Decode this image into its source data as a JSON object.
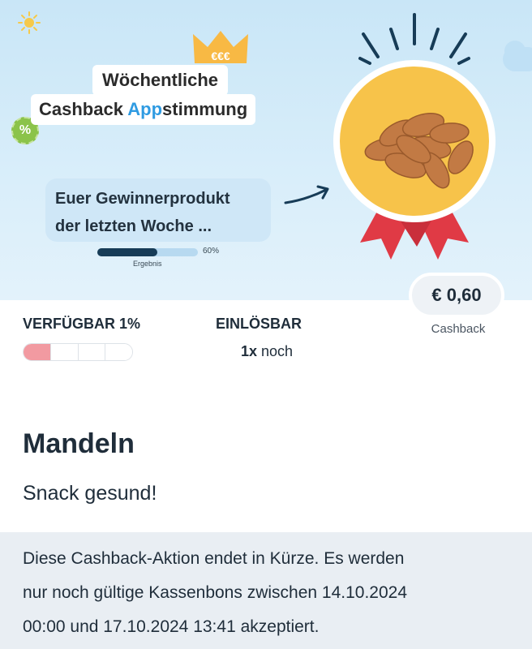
{
  "banner": {
    "crown_text": "€€€",
    "title_line1": "Wöchentliche",
    "title_line2_prefix": "Cashback ",
    "title_line2_accent": "App",
    "title_line2_suffix": "stimmung",
    "percent_badge": "%",
    "winner_line1": "Euer Gewinnerprodukt",
    "winner_line2": "der letzten Woche ...",
    "progress_percent_text": "60%",
    "progress_fraction": 0.6,
    "progress_label": "Ergebnis",
    "medal_icon": "almonds-medal-icon",
    "colors": {
      "accent": "#2f9be2",
      "medal": "#f7c34a",
      "ribbon": "#e03a45"
    }
  },
  "cashback": {
    "amount": "€ 0,60",
    "label": "Cashback"
  },
  "availability": {
    "label": "VERFÜGBAR 1%",
    "segments_total": 4,
    "segments_filled": 1,
    "fill_color": "#f29aa1"
  },
  "redeemable": {
    "label": "EINLÖSBAR",
    "count": "1x",
    "suffix": " noch"
  },
  "product": {
    "title": "Mandeln",
    "subtitle": "Snack gesund!"
  },
  "notice": {
    "line1": "Diese Cashback-Aktion endet in Kürze. Es werden",
    "line2": "nur noch gültige Kassenbons zwischen 14.10.2024",
    "line3": "00:00 und 17.10.2024 13:41 akzeptiert."
  }
}
